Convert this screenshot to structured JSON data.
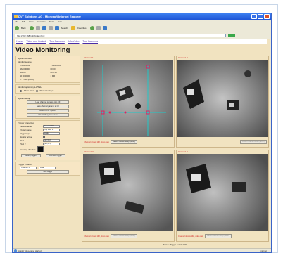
{
  "browser": {
    "title": "DVT Solutions AG - Microsoft Internet Explorer",
    "menu": [
      "File",
      "Edit",
      "View",
      "Favorites",
      "Tools",
      "Help"
    ],
    "toolbar": {
      "back_label": "Back",
      "search_label": "Search",
      "favorites_label": "Favorites"
    },
    "address": "http://192.168.1.11/index.html",
    "status": "Applet video-panel started",
    "zone": "Internet"
  },
  "page": {
    "nav": [
      "Home",
      "Video and Control",
      "Two Cameras",
      "Info Video",
      "Two Cameras"
    ],
    "title": "Video Monitoring"
  },
  "system_control": {
    "title": "System control",
    "monitor_label": "Monitor source",
    "positions": [
      [
        "X:00000000",
        "Y:00000000"
      ],
      [
        "MM:000000",
        "00:00"
      ],
      [
        "MM:00",
        "00:0:00"
      ],
      [
        "MI: 000000",
        "1 MB"
      ]
    ],
    "fps_label": "8 : 1.000 fps/chg"
  },
  "monitor_options": {
    "title": "Monitor options (ALL/SEL)",
    "option1": "Show FOV",
    "option2": "Show Overlays"
  },
  "system_setup": {
    "title": "System setup",
    "buttons": [
      "Load channel params from CF",
      "Save channel params to CF",
      "Restart DVT system",
      "Shut DVT system down"
    ]
  },
  "trigger_properties": {
    "title": "Trigger properties",
    "rows": [
      [
        "Video channel",
        "Camera #1"
      ],
      [
        "Trigger name",
        "Top Row 1"
      ],
      [
        "Trigger type",
        "LINE"
      ],
      [
        "Monitor active",
        ""
      ],
      [
        "Pixel 1",
        "(12,572)"
      ],
      [
        "Pixel 2",
        "(29,575)"
      ]
    ],
    "direction_label": "Crossing direction",
    "modify_label": "Modify trigger",
    "remove_label": "Remove trigger"
  },
  "trigger_creation": {
    "title": "Trigger creation",
    "channel": "Channel 1",
    "type": "LINE",
    "add_label": "Add trigger"
  },
  "channels": [
    {
      "title": "Channel 1",
      "info": "Channel shows 192, video cam",
      "btn": "Reset channel setup (abort)"
    },
    {
      "title": "Channel 2",
      "info": "",
      "btn": "Reset channel setup (abort)"
    },
    {
      "title": "Channel 3",
      "info": "Channel shows 192, video cam",
      "btn": "Reset channel setup (abort)"
    },
    {
      "title": "Channel 4",
      "info": "Channel shows 192, video cam",
      "btn": "Reset channel setup (abort)"
    }
  ],
  "status_line": "Status: Trigger selected OK",
  "colors": {
    "accent": "#d02020",
    "panel": "#f1e3c0",
    "overlay_line": "#20c8c8",
    "overlay_marker": "#e02060"
  }
}
